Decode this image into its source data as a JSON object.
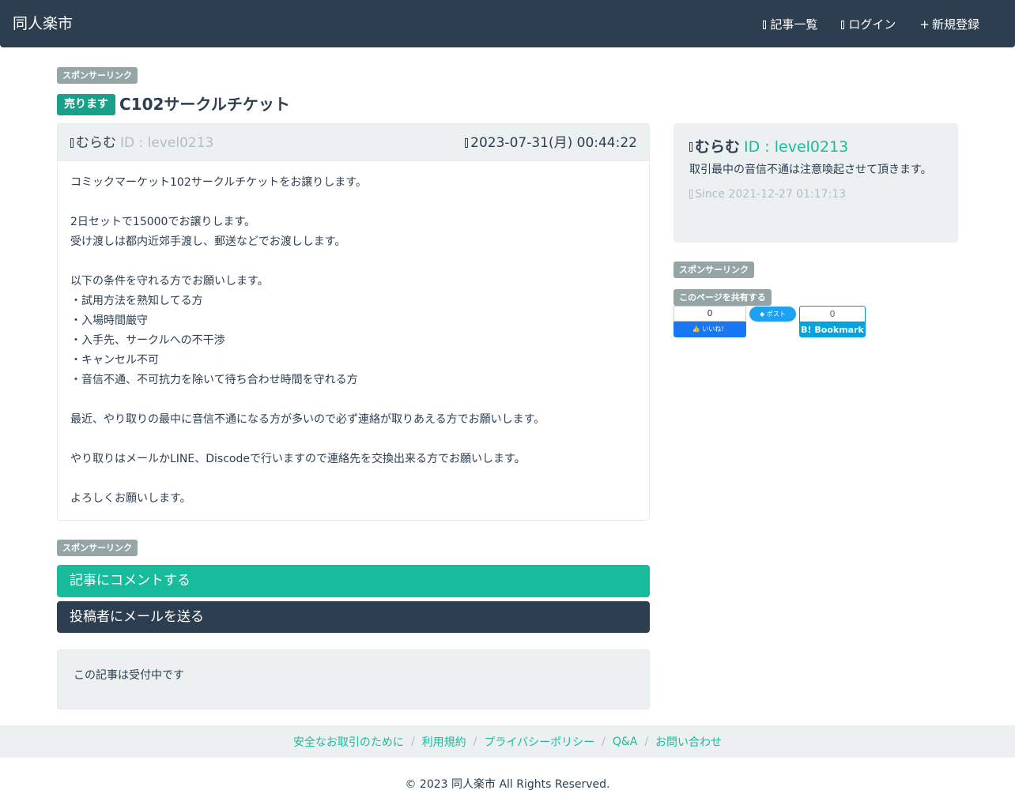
{
  "header": {
    "brand": "同人楽市",
    "nav": {
      "articles": "記事一覧",
      "login": "ログイン",
      "register": "新規登録"
    }
  },
  "ads": {
    "label": "スポンサーリンク"
  },
  "post": {
    "type_badge": "売ります",
    "title": "C102サークルチケット",
    "author_name": "むらむ",
    "author_id": "ID : level0213",
    "date": "2023-07-31(月) 00:44:22",
    "body": [
      "コミックマーケット102サークルチケットをお譲りします。",
      "",
      "2日セットで15000でお譲りします。",
      "受け渡しは都内近郊手渡し、郵送などでお渡しします。",
      "",
      "以下の条件を守れる方でお願いします。",
      "・試用方法を熟知してる方",
      "・入場時間厳守",
      "・入手先、サークルへの不干渉",
      "・キャンセル不可",
      "・音信不通、不可抗力を除いて待ち合わせ時間を守れる方",
      "",
      "最近、やり取りの最中に音信不通になる方が多いので必ず連絡が取りあえる方でお願いします。",
      "",
      "やり取りはメールかLINE、Discodeで行いますので連絡先を交換出来る方でお願いします。",
      "",
      "よろしくお願いします。"
    ]
  },
  "sidebar": {
    "author_name": "むらむ",
    "author_id": "ID : level0213",
    "description": "取引最中の音信不通は注意喚起させて頂きます。",
    "since": "Since 2021-12-27 01:17:13",
    "share_label": "このページを共有する",
    "share": {
      "fb_count": "0",
      "fb_label": "いいね！",
      "tweet_label": "ポスト",
      "hatena_count": "0",
      "hatena_label": "B! Bookmark"
    }
  },
  "actions": {
    "comment": "記事にコメントする",
    "mail": "投稿者にメールを送る"
  },
  "status": "この記事は受付中です",
  "footer": {
    "links": [
      "安全なお取引のために",
      "利用規約",
      "プライバシーポリシー",
      "Q&A",
      "お問い合わせ"
    ],
    "copyright": "© 2023 同人楽市 All Rights Reserved."
  },
  "colors": {
    "navbar": "#2c3e50",
    "accent": "#18bc9c",
    "sell_badge": "#18a08a",
    "gray_badge": "#95a5a6",
    "panel": "#ecf0f1"
  }
}
